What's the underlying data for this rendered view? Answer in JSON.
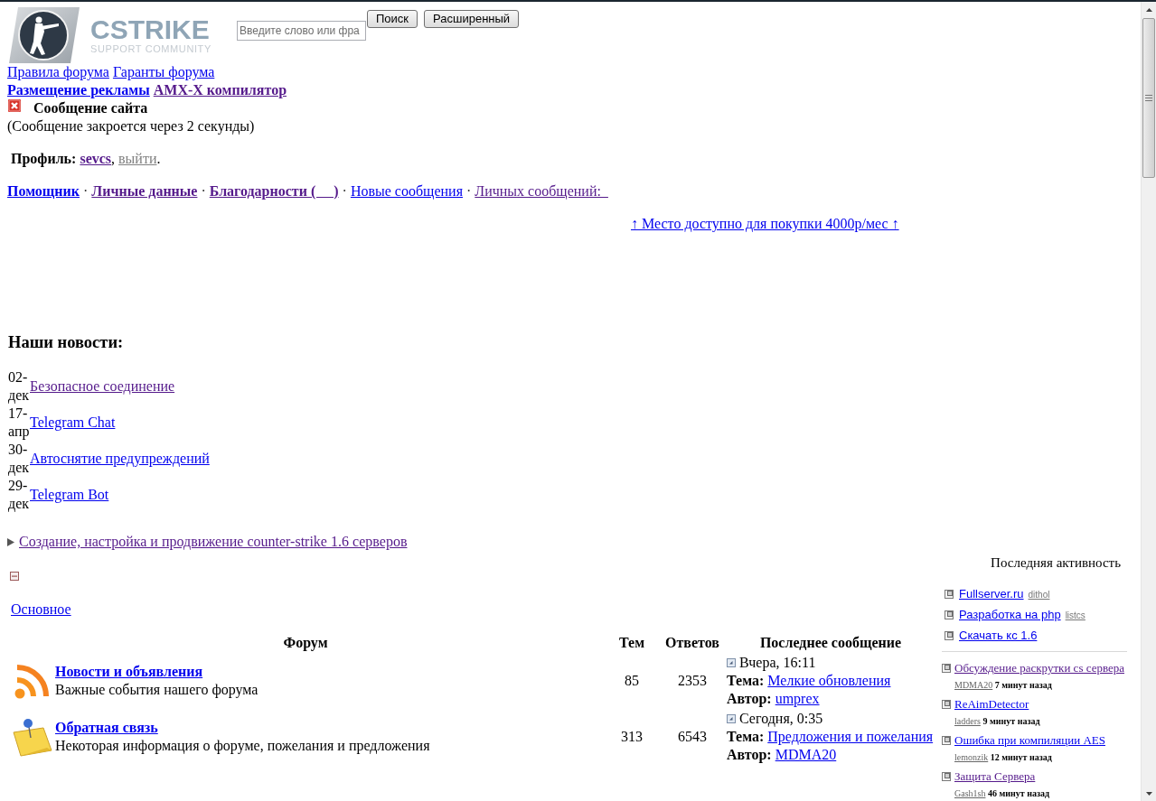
{
  "header": {
    "logo": {
      "title": "CSTRIKE",
      "subtitle": "SUPPORT COMMUNITY"
    },
    "search": {
      "placeholder": "Введите слово или фра"
    },
    "buttons": [
      "Поиск",
      "Расширенный"
    ]
  },
  "top_links": [
    [
      {
        "kind": "link",
        "text": "Правила форума",
        "visited": false
      },
      {
        "kind": "link",
        "text": "Гаранты форума",
        "visited": false
      }
    ],
    [
      {
        "kind": "strong-link",
        "text": "Размещение рекламы",
        "visited": false
      },
      {
        "kind": "strong-link",
        "text": "AMX-X компилятор",
        "visited": true
      }
    ]
  ],
  "site_message": {
    "title": "Сообщение сайта",
    "note": "(Сообщение закроется через 2 секунды)"
  },
  "profile": [
    {
      "kind": "label",
      "text": "Профиль:"
    },
    {
      "kind": "strong-link",
      "text": "sevcs",
      "visited": true
    },
    {
      "kind": "punct",
      "text": ","
    },
    {
      "kind": "muted-link",
      "text": "выйти"
    },
    {
      "kind": "punct",
      "text": "."
    }
  ],
  "nav": [
    {
      "kind": "strong-link",
      "text": "Помощник",
      "visited": false
    },
    {
      "kind": "separator",
      "text": "·"
    },
    {
      "kind": "strong-link",
      "text": "Личные данные",
      "visited": true
    },
    {
      "kind": "separator",
      "text": "·"
    },
    {
      "kind": "strong-link",
      "text": "Благодарности (     )",
      "visited": true
    },
    {
      "kind": "separator",
      "text": "·"
    },
    {
      "kind": "link",
      "text": "Новые сообщения",
      "visited": false
    },
    {
      "kind": "separator",
      "text": "·"
    },
    {
      "kind": "link",
      "text": "Личных сообщений:  ",
      "visited": true
    }
  ],
  "ad_link": "↑ Место доступно для покупки 4000р/мес ↑",
  "news": {
    "title": "Наши новости:",
    "items": [
      {
        "date": "02-дек",
        "title": "Безопасное соединение",
        "visited": true
      },
      {
        "date": "17-апр",
        "title": "Telegram Chat",
        "visited": false
      },
      {
        "date": "30-дек",
        "title": "Автоснятие предупреждений",
        "visited": false
      },
      {
        "date": "29-дек",
        "title": "Telegram Bot",
        "visited": false
      }
    ]
  },
  "category": {
    "title": "Создание, настройка и продвижение counter-strike 1.6 серверов",
    "expanded": false,
    "visited": true
  },
  "section": {
    "expanded": true,
    "title": "Основное",
    "columns": [
      "Форум",
      "Тем",
      "Ответов",
      "Последнее сообщение"
    ],
    "rows": [
      {
        "kind": "rss",
        "title": "Новости и объявления",
        "description": "Важные события нашего форума",
        "topics": "85",
        "replies": "2353",
        "last_post": {
          "time": "Вчера, 16:11",
          "topic_label": "Тема:",
          "topic": "Мелкие обновления",
          "author_label": "Автор:",
          "author": "umprex"
        }
      },
      {
        "kind": "note",
        "title": "Обратная связь",
        "description": "Некоторая информация о форуме, пожелания и предложения",
        "topics": "313",
        "replies": "6543",
        "last_post": {
          "time": "Сегодня, 0:35",
          "topic_label": "Тема:",
          "topic": "Предложения и пожелания",
          "author_label": "Автор:",
          "author": "MDMA20"
        }
      }
    ]
  },
  "sidebar": {
    "title": "Последняя активность",
    "links": [
      {
        "title": "Fullserver.ru",
        "user": "dithol"
      },
      {
        "title": "Разработка на php",
        "user": "listcs"
      },
      {
        "title": "Скачать кс 1.6"
      }
    ],
    "topics": [
      {
        "title": "Обсуждение раскрутки cs сервера",
        "visited": true,
        "user": "MDMA20",
        "time": "7 минут назад"
      },
      {
        "title": "ReAimDetector",
        "visited": false,
        "user": "ladders",
        "time": "9 минут назад"
      },
      {
        "title": "Ошибка при компиляции AES",
        "visited": false,
        "user": "lemonzik",
        "time": "12 минут назад"
      },
      {
        "title": "Защита Сервера",
        "visited": true,
        "user": "Gash1sh",
        "time": "46 минут назад"
      }
    ]
  }
}
